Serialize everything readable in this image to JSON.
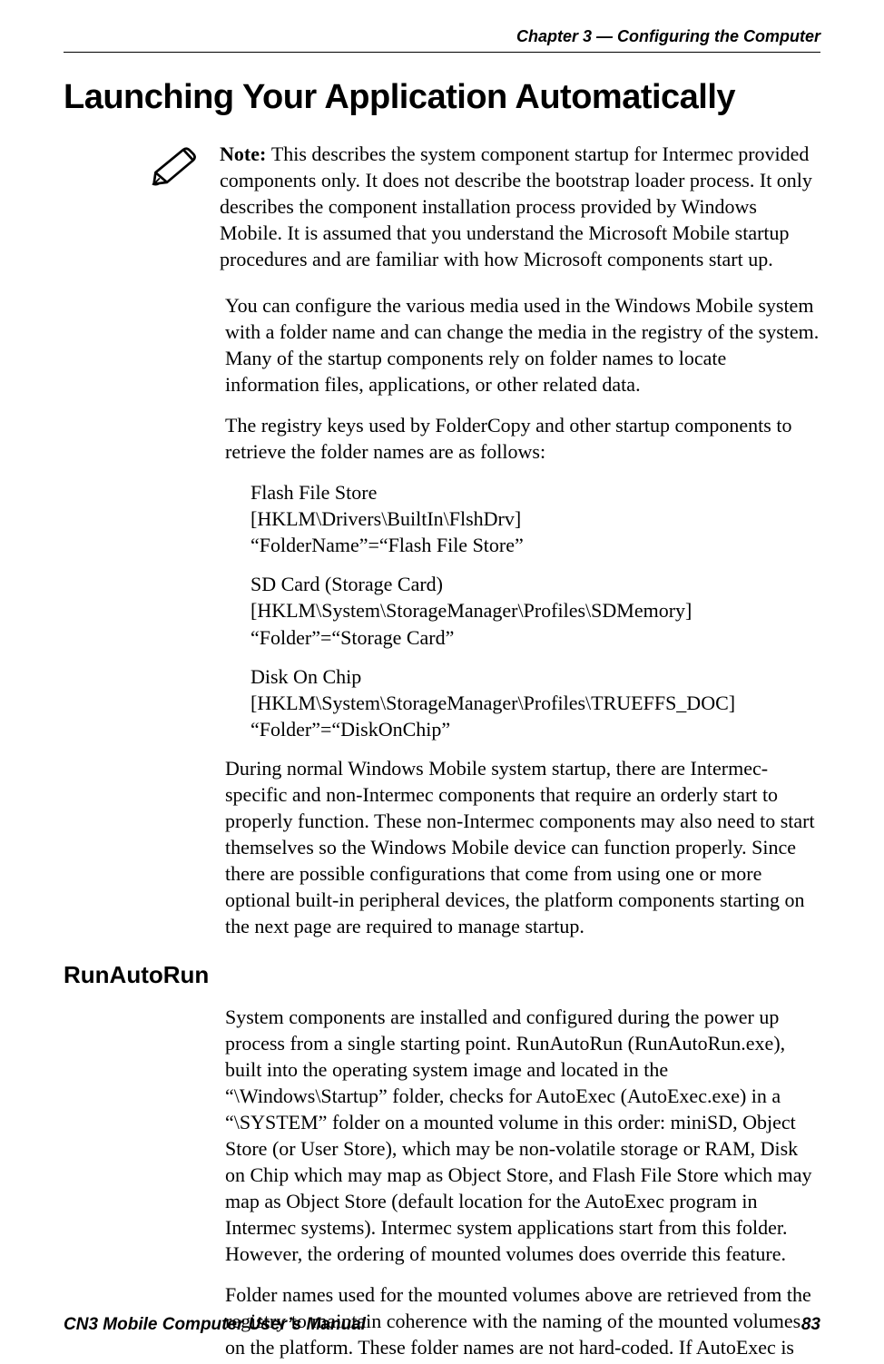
{
  "header": {
    "chapter_prefix": "Chapter 3 —  ",
    "chapter_title": "Configuring the Computer"
  },
  "section": {
    "title": "Launching Your Application Automatically",
    "note_label": "Note: ",
    "note_body": "This describes the system component startup for Intermec provided components only. It does not describe the bootstrap loader process. It only describes the component installation process provided by Windows Mobile. It is assumed that you understand the Microsoft Mobile startup procedures and are familiar with how Microsoft components start up.",
    "para1": "You can configure the various media used in the Windows Mobile system with a folder name and can change the media in the registry of the system. Many of the startup components rely on folder names to locate information files, applications, or other related data.",
    "para2": "The registry keys used by FolderCopy and other startup components to retrieve the folder names are as follows:",
    "registry": [
      {
        "name": "Flash File Store",
        "path": "[HKLM\\Drivers\\BuiltIn\\FlshDrv]",
        "value": "“FolderName”=“Flash File Store”"
      },
      {
        "name": "SD Card (Storage Card)",
        "path": "[HKLM\\System\\StorageManager\\Profiles\\SDMemory]",
        "value": "“Folder”=“Storage Card”"
      },
      {
        "name": "Disk On Chip",
        "path": "[HKLM\\System\\StorageManager\\Profiles\\TRUEFFS_DOC]",
        "value": "“Folder”=“DiskOnChip”"
      }
    ],
    "para3": "During normal Windows Mobile system startup, there are Intermec-specific and non-Intermec components that require an orderly start to properly function. These non-Intermec components may also need to start themselves so the Windows Mobile device can function properly. Since there are possible configurations that come from using one or more optional built-in peripheral devices, the platform components starting on the next page are required to manage startup."
  },
  "subsection": {
    "title": "RunAutoRun",
    "para1": "System components are installed and configured during the power up process from a single starting point. RunAutoRun (RunAutoRun.exe), built into the operating system image and located in the “\\Windows\\Startup” folder, checks for AutoExec (AutoExec.exe) in a “\\SYSTEM” folder on a mounted volume in this order: miniSD, Object Store (or User Store), which may be non-volatile storage or RAM, Disk on Chip which may map as Object Store, and Flash File Store which may map as Object Store (default location for the AutoExec program in Intermec systems). Intermec system applications start from this folder. However, the ordering of mounted volumes does override this feature.",
    "para2": "Folder names used for the mounted volumes above are retrieved from the registry to maintain coherence with the naming of the mounted volumes on the platform. These folder names are not hard-coded. If AutoExec is"
  },
  "footer": {
    "manual_title": "CN3 Mobile Computer User’s Manual",
    "page_number": "83"
  }
}
